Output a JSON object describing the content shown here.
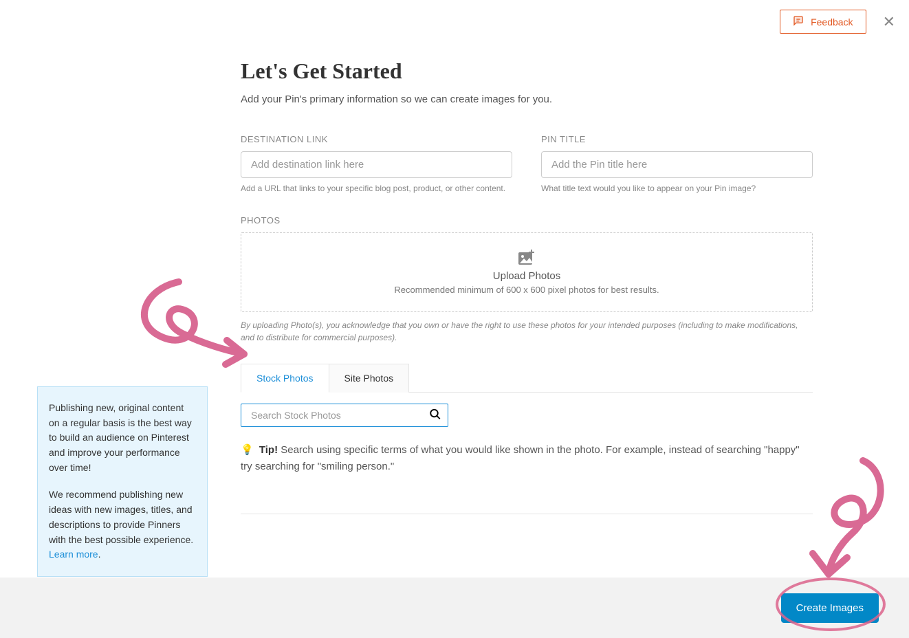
{
  "topbar": {
    "feedback_label": "Feedback",
    "close_label": "✕"
  },
  "heading": "Let's Get Started",
  "subtitle": "Add your Pin's primary information so we can create images for you.",
  "form": {
    "dest_label": "DESTINATION LINK",
    "dest_placeholder": "Add destination link here",
    "dest_helper": "Add a URL that links to your specific blog post, product, or other content.",
    "title_label": "PIN TITLE",
    "title_placeholder": "Add the Pin title here",
    "title_helper": "What title text would you like to appear on your Pin image?"
  },
  "photos": {
    "section_label": "PHOTOS",
    "upload_title": "Upload Photos",
    "upload_sub": "Recommended minimum of 600 x 600 pixel photos for best results.",
    "disclaimer": "By uploading Photo(s), you acknowledge that you own or have the right to use these photos for your intended purposes (including to make modifications, and to distribute for commercial purposes)."
  },
  "tabs": {
    "stock": "Stock Photos",
    "site": "Site Photos"
  },
  "search": {
    "placeholder": "Search Stock Photos"
  },
  "tip": {
    "bulb": "💡",
    "label": "Tip!",
    "text": " Search using specific terms of what you would like shown in the photo. For example, instead of searching \"happy\" try searching for \"smiling person.\""
  },
  "sidebar": {
    "p1": "Publishing new, original content on a regular basis is the best way to build an audience on Pinterest and improve your performance over time!",
    "p2_prefix": "We recommend publishing new ideas with new images, titles, and descriptions to provide Pinners with the best possible experience. ",
    "learn_more": "Learn more",
    "period": "."
  },
  "footer": {
    "create_label": "Create Images"
  }
}
